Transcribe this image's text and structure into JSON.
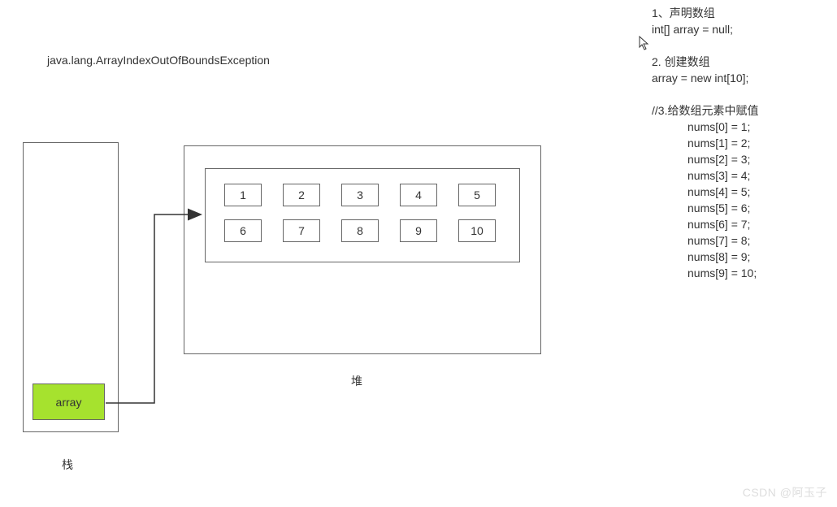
{
  "title": "java.lang.ArrayIndexOutOfBoundsException",
  "stack": {
    "label": "栈",
    "varLabel": "array"
  },
  "heap": {
    "label": "堆",
    "cells": [
      "1",
      "2",
      "3",
      "4",
      "5",
      "6",
      "7",
      "8",
      "9",
      "10"
    ]
  },
  "code": {
    "section1_title": "1、声明数组",
    "section1_line": "int[] array = null;",
    "section2_title": "2. 创建数组",
    "section2_line": "array = new int[10];",
    "section3_title": "//3.给数组元素中赋值",
    "assigns": [
      "nums[0] = 1;",
      "nums[1] = 2;",
      "nums[2] = 3;",
      "nums[3] = 4;",
      "nums[4] = 5;",
      "nums[5] = 6;",
      "nums[6] = 7;",
      "nums[7] = 8;",
      "nums[8] = 9;",
      "nums[9] = 10;"
    ]
  },
  "watermark": "CSDN @阿玉子"
}
